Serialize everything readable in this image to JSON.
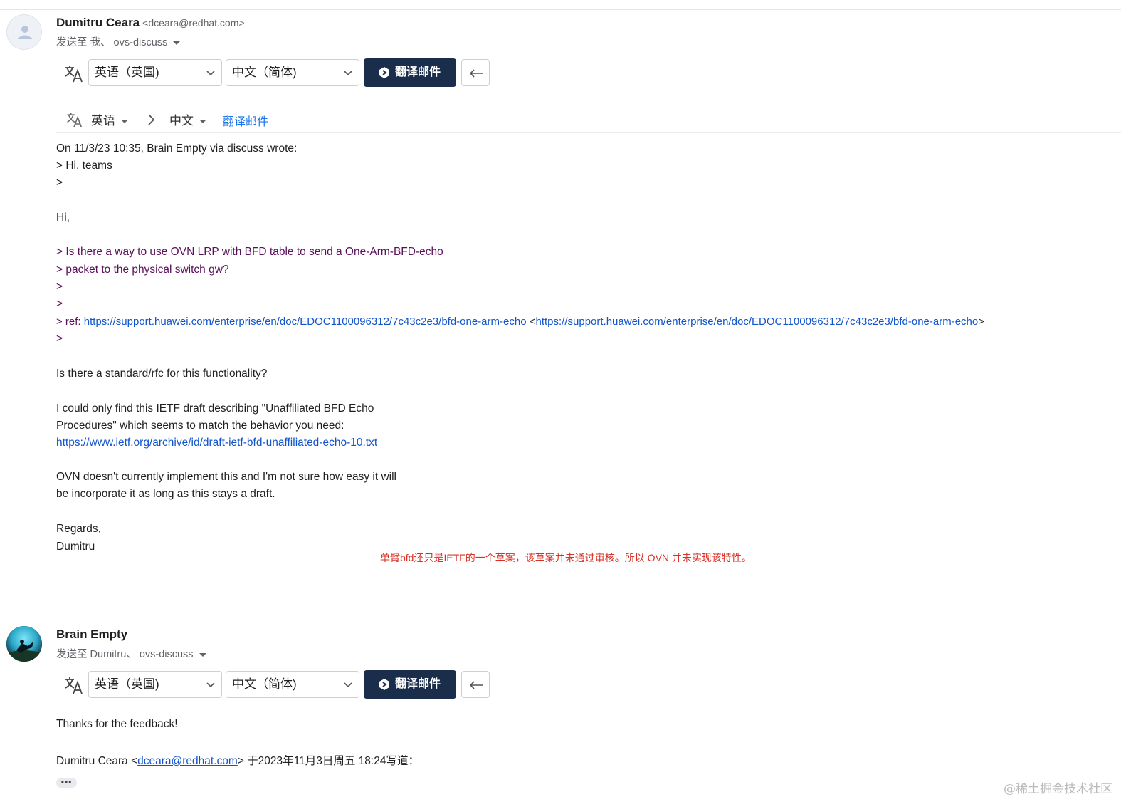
{
  "message1": {
    "sender_name": "Dumitru Ceara",
    "sender_email": "<dceara@redhat.com>",
    "sent_to": "发送至 我、 ovs-discuss",
    "translate_bar": {
      "source_lang": "英语（英国)",
      "target_lang": "中文（简体)",
      "translate_button": "翻译邮件"
    },
    "translate_strip": {
      "source": "英语",
      "target": "中文",
      "link": "翻译邮件"
    },
    "body": {
      "l1": "On 11/3/23 10:35, Brain Empty via discuss wrote:",
      "l2": "> Hi, teams",
      "l3": ">",
      "l4": "Hi,",
      "l5": "> Is there a way to use OVN LRP with BFD table to send a One-Arm-BFD-echo",
      "l6": "> packet to the physical switch gw?",
      "l7": ">",
      "l8": ">",
      "l9_prefix": "> ref: ",
      "l9_link1": "https://support.huawei.com/enterprise/en/doc/EDOC1100096312/7c43c2e3/bfd-one-arm-echo",
      "l9_mid": " <",
      "l9_link2": "https://support.huawei.com/enterprise/en/doc/EDOC1100096312/7c43c2e3/bfd-one-arm-echo",
      "l9_suffix": ">",
      "l10": ">",
      "l11": "Is there a standard/rfc for this functionality?",
      "l12": "I could only find this IETF draft describing \"Unaffiliated BFD Echo",
      "l13": "Procedures\" which seems to match the behavior you need:",
      "l14_link": "https://www.ietf.org/archive/id/draft-ietf-bfd-unaffiliated-echo-10.txt",
      "l15": "OVN doesn't currently implement this and I'm not sure how easy it will",
      "l16": "be incorporate it as long as this stays a draft.",
      "l17": "Regards,",
      "l18": "Dumitru"
    },
    "annotation": "单臂bfd还只是IETF的一个草案，该草案并未通过审核。所以 OVN 并未实现该特性。"
  },
  "message2": {
    "sender_name": "Brain Empty",
    "sent_to": "发送至 Dumitru、 ovs-discuss",
    "translate_bar": {
      "source_lang": "英语（英国)",
      "target_lang": "中文（简体)",
      "translate_button": "翻译邮件"
    },
    "body": {
      "l1": "Thanks for the feedback!",
      "l2_prefix": "Dumitru Ceara <",
      "l2_link": "dceara@redhat.com",
      "l2_suffix": "> 于2023年11月3日周五 18:24写道：",
      "dots": "•••"
    }
  },
  "watermark": "@稀土掘金技术社区",
  "colors": {
    "translate_button_bg": "#1a2d4a",
    "link": "#1155cc",
    "quote": "#5a0f5a",
    "annotation": "#d93025"
  }
}
